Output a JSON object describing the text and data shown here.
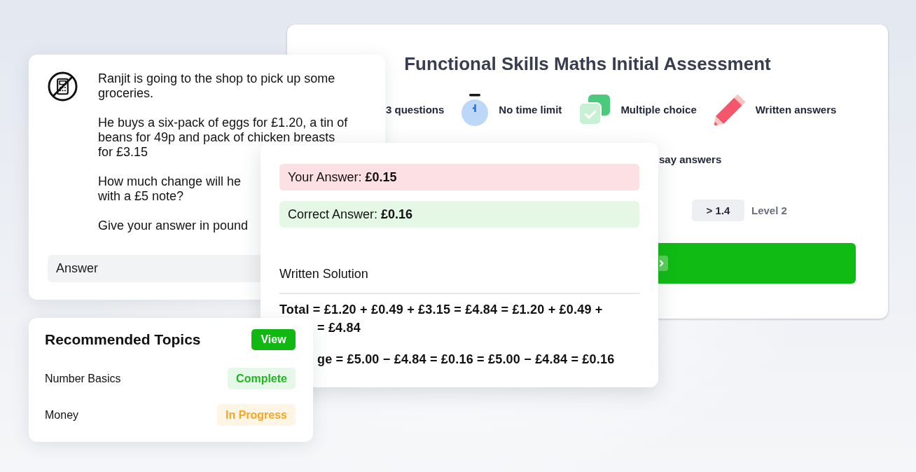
{
  "assessment_card": {
    "title": "Functional Skills Maths Initial Assessment",
    "features": [
      {
        "kind": "count",
        "label": "3 questions"
      },
      {
        "kind": "time_limit",
        "label": "No time limit"
      },
      {
        "kind": "multiple_choice",
        "label": "Multiple choice"
      },
      {
        "kind": "written",
        "label": "Written answers"
      }
    ],
    "features_row_2": [
      {
        "label": "say answers"
      }
    ],
    "level": {
      "value": "> 1.4",
      "label": "Level 2"
    }
  },
  "question_card": {
    "paragraphs": [
      [
        "Ranjit is going to the shop to pick up some",
        "groceries."
      ],
      [
        "He buys a six-pack of eggs for £1.20, a tin of",
        "beans for 49p and pack of chicken breasts",
        "for £3.15"
      ],
      [
        "How much change will he",
        "with a £5 note?"
      ],
      [
        "Give your answer in pound"
      ]
    ],
    "answer_field": {
      "placeholder": "Answer"
    }
  },
  "review_card": {
    "answers": [
      {
        "text": "Your Answer: **£0.15**",
        "correct": false
      },
      {
        "text": "Correct Answer: **£0.16**",
        "correct": true
      }
    ],
    "solution": {
      "title": "Written Solution",
      "paragraphs": [
        [
          "Total = £1.20 + £0.49 + £3.15 = £4.84 = £1.20 + £0.49 +",
          "= £4.84"
        ],
        [
          "ge = £5.00 − £4.84 = £0.16 = £5.00 − £4.84 = £0.16"
        ]
      ]
    }
  },
  "topics_card": {
    "title": "Recommended Topics",
    "view_button": "View",
    "topics": [
      {
        "name": "Number Basics",
        "complete": true,
        "status_label": "Complete"
      },
      {
        "name": "Money",
        "complete": false,
        "status_label": "In Progress"
      }
    ]
  }
}
